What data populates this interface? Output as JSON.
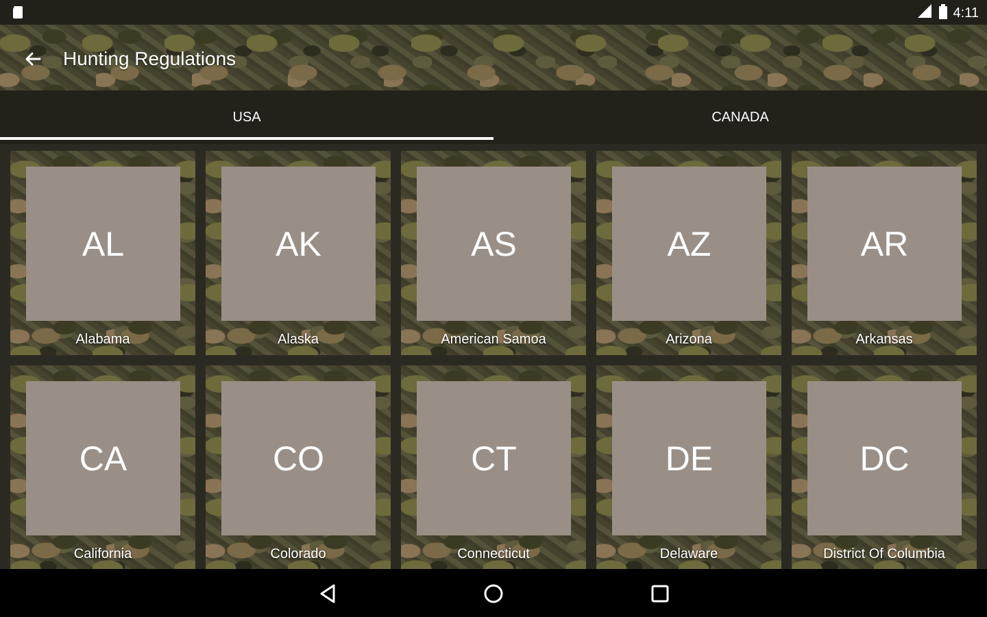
{
  "status_bar": {
    "time": "4:11",
    "network": "3G"
  },
  "toolbar": {
    "title": "Hunting Regulations"
  },
  "tabs": [
    {
      "label": "USA",
      "selected": true
    },
    {
      "label": "CANADA",
      "selected": false
    }
  ],
  "states": [
    {
      "abbr": "AL",
      "name": "Alabama"
    },
    {
      "abbr": "AK",
      "name": "Alaska"
    },
    {
      "abbr": "AS",
      "name": "American Samoa"
    },
    {
      "abbr": "AZ",
      "name": "Arizona"
    },
    {
      "abbr": "AR",
      "name": "Arkansas"
    },
    {
      "abbr": "CA",
      "name": "California"
    },
    {
      "abbr": "CO",
      "name": "Colorado"
    },
    {
      "abbr": "CT",
      "name": "Connecticut"
    },
    {
      "abbr": "DE",
      "name": "Delaware"
    },
    {
      "abbr": "DC",
      "name": "District Of Columbia"
    }
  ],
  "colors": {
    "tile": "#9a8f86",
    "tab_bar": "#22221b",
    "indicator": "#ffffff"
  }
}
